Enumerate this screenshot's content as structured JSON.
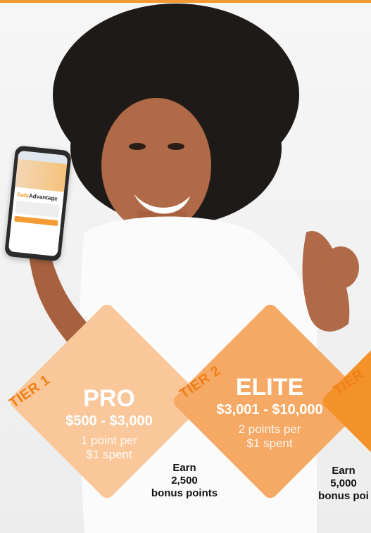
{
  "tiers": [
    {
      "tag": "TIER 1",
      "name": "PRO",
      "range": "$500 - $3,000",
      "points_line1": "1 point per",
      "points_line2": "$1 spent",
      "bonus_line1": "Earn",
      "bonus_line2": "2,500",
      "bonus_line3": "bonus points"
    },
    {
      "tag": "TIER 2",
      "name": "ELITE",
      "range": "$3,001 - $10,000",
      "points_line1": "2 points per",
      "points_line2": "$1 spent",
      "bonus_line1": "Earn",
      "bonus_line2": "5,000",
      "bonus_line3": "bonus poi"
    },
    {
      "tag": "TIER"
    }
  ],
  "phone": {
    "logo_text_1": "Safe",
    "logo_text_2": "Advantage"
  },
  "colors": {
    "accent": "#f39a32",
    "tier1": "#f9c79a",
    "tier2": "#f6a964",
    "tier3": "#f39229"
  }
}
